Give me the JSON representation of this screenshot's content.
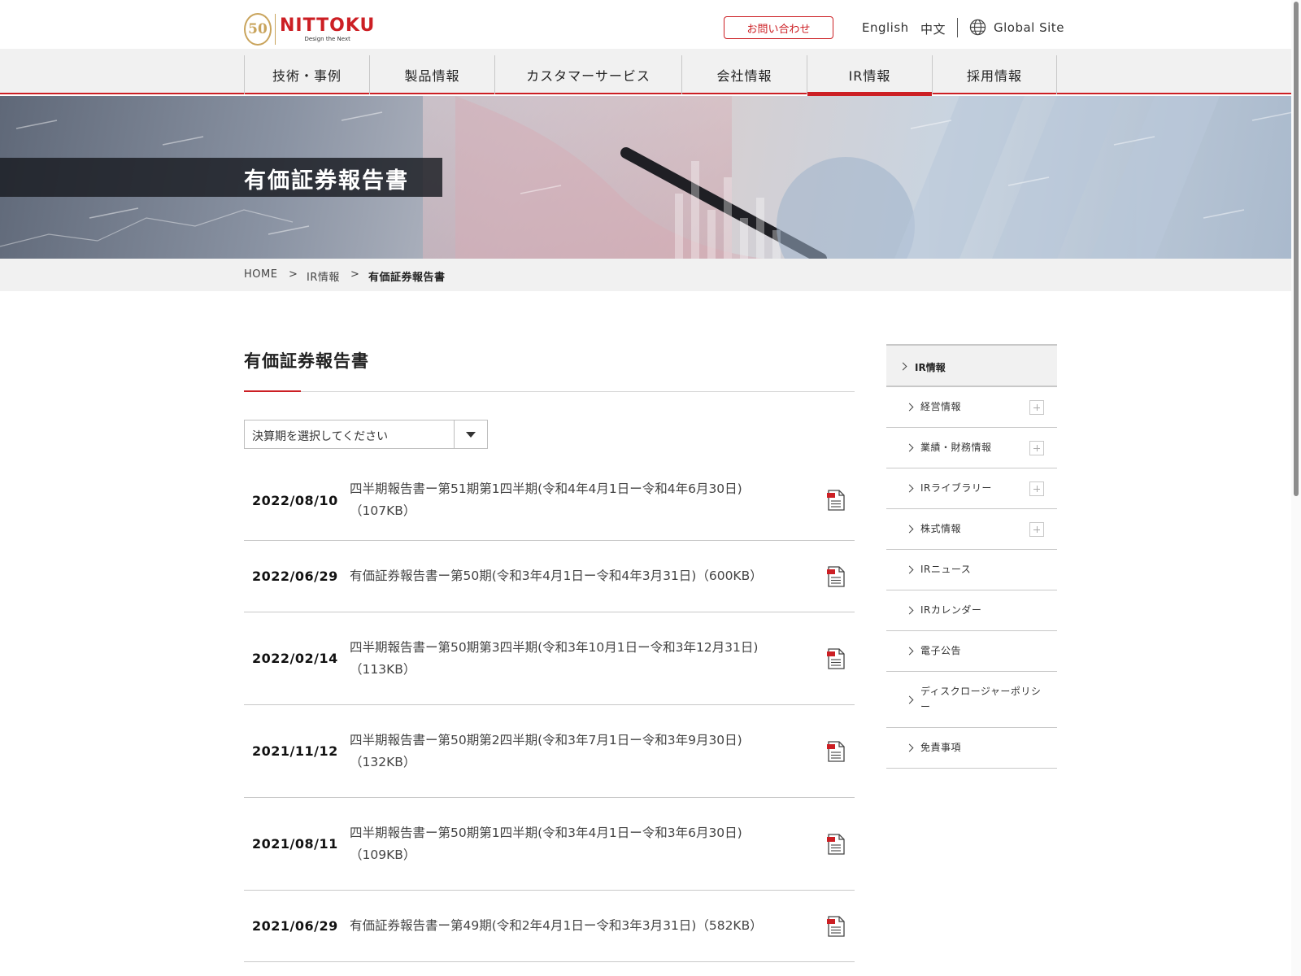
{
  "header": {
    "logo": {
      "badge": "50",
      "wordmark": "NITTOKU",
      "tagline": "Design the Next"
    },
    "contact_label": "お問い合わせ",
    "lang_english": "English",
    "lang_chinese": "中文",
    "global_site": "Global Site"
  },
  "nav": {
    "items": [
      {
        "label": "技術・事例"
      },
      {
        "label": "製品情報"
      },
      {
        "label": "カスタマーサービス"
      },
      {
        "label": "会社情報"
      },
      {
        "label": "IR情報",
        "active": true
      },
      {
        "label": "採用情報"
      }
    ]
  },
  "hero": {
    "title": "有価証券報告書"
  },
  "breadcrumb": {
    "home": "HOME",
    "sep": ">",
    "ir": "IR情報",
    "current": "有価証券報告書"
  },
  "main": {
    "title": "有価証券報告書",
    "select_placeholder": "決算期を選択してください",
    "documents": [
      {
        "date": "2022/08/10",
        "title": "四半期報告書ー第51期第1四半期(令和4年4月1日ー令和4年6月30日)",
        "size": "（107KB）"
      },
      {
        "date": "2022/06/29",
        "title": "有価証券報告書ー第50期(令和3年4月1日ー令和4年3月31日)（600KB）",
        "size": ""
      },
      {
        "date": "2022/02/14",
        "title": "四半期報告書ー第50期第3四半期(令和3年10月1日ー令和3年12月31日)",
        "size": "（113KB）"
      },
      {
        "date": "2021/11/12",
        "title": "四半期報告書ー第50期第2四半期(令和3年7月1日ー令和3年9月30日)",
        "size": "（132KB）"
      },
      {
        "date": "2021/08/11",
        "title": "四半期報告書ー第50期第1四半期(令和3年4月1日ー令和3年6月30日)",
        "size": "（109KB）"
      },
      {
        "date": "2021/06/29",
        "title": "有価証券報告書ー第49期(令和2年4月1日ー令和3年3月31日)（582KB）",
        "size": ""
      }
    ],
    "pdf_icon_label": "PDF"
  },
  "sidebar": {
    "head": "IR情報",
    "items": [
      {
        "label": "経営情報",
        "expandable": true
      },
      {
        "label": "業績・財務情報",
        "expandable": true
      },
      {
        "label": "IRライブラリー",
        "expandable": true
      },
      {
        "label": "株式情報",
        "expandable": true
      },
      {
        "label": "IRニュース",
        "expandable": false
      },
      {
        "label": "IRカレンダー",
        "expandable": false
      },
      {
        "label": "電子公告",
        "expandable": false
      },
      {
        "label": "ディスクロージャーポリシー",
        "expandable": false
      },
      {
        "label": "免責事項",
        "expandable": false
      }
    ]
  },
  "colors": {
    "accent": "#cc1f24",
    "gold": "#c9a45c",
    "nav_bg": "#f1f1f1"
  }
}
